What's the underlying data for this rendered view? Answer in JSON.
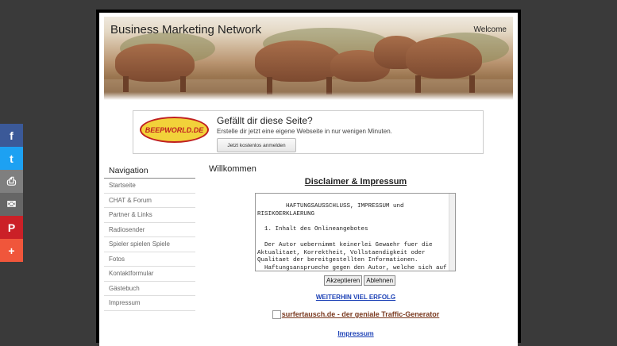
{
  "share": {
    "facebook_glyph": "f",
    "twitter_glyph": "t",
    "print_glyph": "⎙",
    "mail_glyph": "✉",
    "pinterest_glyph": "P",
    "more_glyph": "+",
    "colors": [
      "#3b5998",
      "#1da1f2",
      "#7f7f7f",
      "#666666",
      "#cb2027",
      "#f0563b"
    ]
  },
  "header": {
    "site_title": "Business Marketing Network",
    "welcome": "Welcome"
  },
  "promo": {
    "logo_text": "BEEPWORLD.DE",
    "title": "Gefällt dir diese Seite?",
    "subtitle": "Erstelle dir jetzt eine eigene Webseite in nur wenigen Minuten.",
    "button": "Jetzt kostenlos anmelden"
  },
  "nav": {
    "heading": "Navigation",
    "items": [
      "Startseite",
      "CHAT & Forum",
      "Partner & Links",
      "Radiosender",
      "Spieler spielen Spiele",
      "Fotos",
      "Kontaktformular",
      "Gästebuch",
      "Impressum"
    ]
  },
  "content": {
    "title": "Willkommen",
    "disclaimer_title": "Disclaimer & Impressum",
    "disclaimer_text": "HAFTUNGSAUSSCHLUSS, IMPRESSUM und RISIKOERKLAERUNG\n\n  1. Inhalt des Onlineangebotes\n\n  Der Autor uebernimmt keinerlei Gewaehr fuer die Aktualitaet, Korrektheit, Vollstaendigkeit oder Qualitaet der bereitgestellten Informationen.\n  Haftungsansprueche gegen den Autor, welche sich auf Schaeden materieller oder ideeller Art beziehen, die durch die Nutzung oder Nichtnutzung",
    "accept_button": "Akzeptieren",
    "decline_button": "Ablehnen",
    "link_success": "WEITERHIN VIEL ERFOLG",
    "link_surfer": "surfertausch.de - der geniale Traffic-Generator",
    "link_impressum": "Impressum"
  }
}
